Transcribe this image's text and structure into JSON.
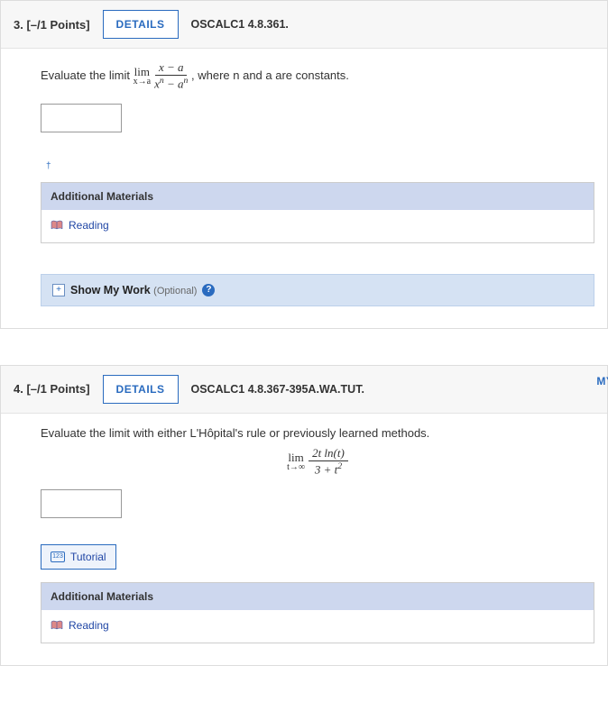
{
  "q3": {
    "number": "3.",
    "points": "[–/1 Points]",
    "details": "DETAILS",
    "source": "OSCALC1 4.8.361.",
    "prompt_pre": "Evaluate the limit ",
    "lim_label": "lim",
    "lim_sub": "x→a",
    "frac_num": "x − a",
    "frac_den_left": "x",
    "frac_den_sup1": "n",
    "frac_den_mid": " − a",
    "frac_den_sup2": "n",
    "prompt_post": ", where n and a are constants.",
    "dagger": "†",
    "addmat_header": "Additional Materials",
    "reading": "Reading",
    "showwork": "Show My Work",
    "optional": "(Optional)"
  },
  "q4": {
    "number": "4.",
    "points": "[–/1 Points]",
    "details": "DETAILS",
    "source": "OSCALC1 4.8.367-395A.WA.TUT.",
    "mynotes": "MY NO",
    "prompt": "Evaluate the limit with either L'Hôpital's rule or previously learned methods.",
    "lim_label": "lim",
    "lim_sub": "t→∞",
    "frac_num_left": "2t ln(",
    "frac_num_var": "t",
    "frac_num_right": ")",
    "frac_den_left": "3 + t",
    "frac_den_sup": "2",
    "tutorial": "Tutorial",
    "addmat_header": "Additional Materials",
    "reading": "Reading"
  }
}
